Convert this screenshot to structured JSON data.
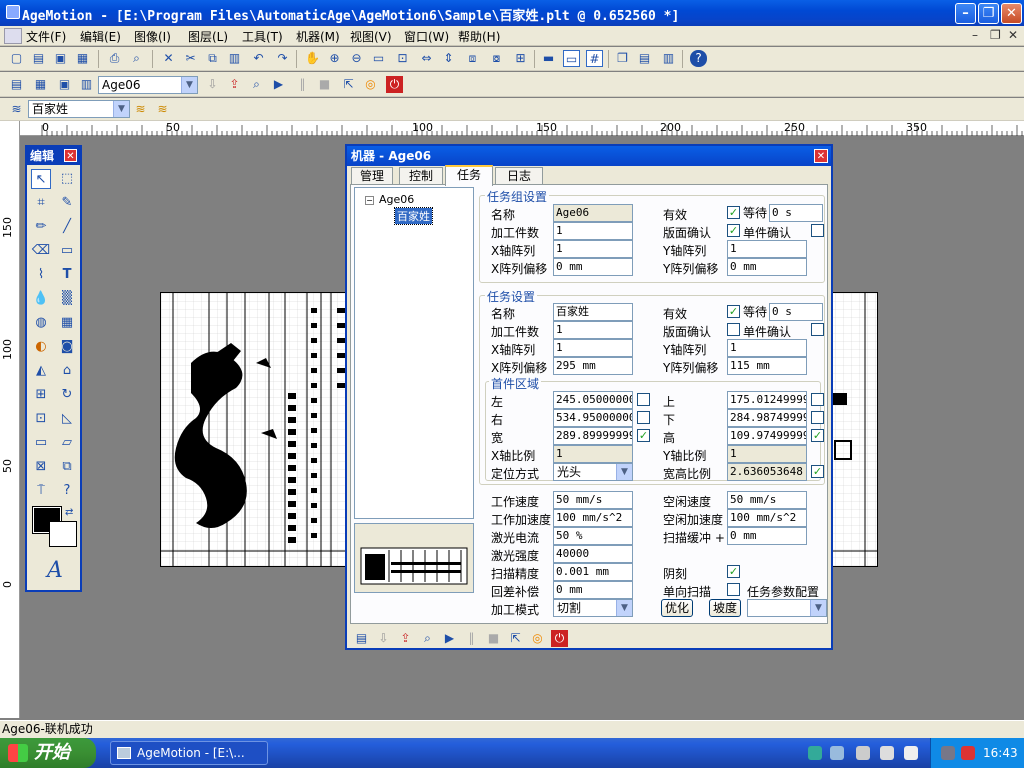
{
  "app": {
    "title": "AgeMotion - [E:\\Program Files\\AutomaticAge\\AgeMotion6\\Sample\\百家姓.plt @ 0.652560 *]"
  },
  "menu": [
    "文件(F)",
    "编辑(E)",
    "图像(I)",
    "图层(L)",
    "工具(T)",
    "机器(M)",
    "视图(V)",
    "窗口(W)",
    "帮助(H)"
  ],
  "toolbar2": {
    "machine": "Age06"
  },
  "toolbar3": {
    "layer": "百家姓"
  },
  "ruler": {
    "h": [
      "0",
      "50",
      "100",
      "150",
      "200",
      "250",
      "300",
      "350"
    ],
    "v": [
      "150",
      "100",
      "50",
      "0"
    ]
  },
  "palette": {
    "title": "编辑"
  },
  "dialog": {
    "title": "机器 - Age06",
    "tabs": [
      "管理",
      "控制",
      "任务",
      "日志"
    ],
    "tree": {
      "root": "Age06",
      "child": "百家姓"
    },
    "group_settings": {
      "title": "任务组设置",
      "name_label": "名称",
      "name": "Age06",
      "count_label": "加工件数",
      "count": "1",
      "xarr_label": "X轴阵列",
      "xarr": "1",
      "xoff_label": "X阵列偏移",
      "xoff": "0 mm",
      "valid_label": "有效",
      "wait_label": "等待",
      "wait": "0 s",
      "confirm_label": "版面确认",
      "piece_label": "单件确认",
      "yarr_label": "Y轴阵列",
      "yarr": "1",
      "yoff_label": "Y阵列偏移",
      "yoff": "0 mm"
    },
    "task_settings": {
      "title": "任务设置",
      "name_label": "名称",
      "name": "百家姓",
      "count_label": "加工件数",
      "count": "1",
      "xarr_label": "X轴阵列",
      "xarr": "1",
      "xoff_label": "X阵列偏移",
      "xoff": "295 mm",
      "valid_label": "有效",
      "wait_label": "等待",
      "wait": "0 s",
      "confirm_label": "版面确认",
      "piece_label": "单件确认",
      "yarr_label": "Y轴阵列",
      "yarr": "1",
      "yoff_label": "Y阵列偏移",
      "yoff": "115 mm"
    },
    "first_region": {
      "title": "首件区域",
      "left_label": "左",
      "left": "245.050000000",
      "right_label": "右",
      "right": "534.950000000",
      "width_label": "宽",
      "width": "289.899999999",
      "xscale_label": "X轴比例",
      "xscale": "1",
      "pos_label": "定位方式",
      "pos": "光头",
      "top_label": "上",
      "top": "175.012499999",
      "bottom_label": "下",
      "bottom": "284.987499999",
      "height_label": "高",
      "height": "109.974999999",
      "yscale_label": "Y轴比例",
      "yscale": "1",
      "ratio_label": "宽高比例",
      "ratio": "2.636053648"
    },
    "params": {
      "work_speed_label": "工作速度",
      "work_speed": "50 mm/s",
      "work_acc_label": "工作加速度",
      "work_acc": "100 mm/s^2",
      "laser_cur_label": "激光电流",
      "laser_cur": "50 %",
      "laser_int_label": "激光强度",
      "laser_int": "40000",
      "scan_prec_label": "扫描精度",
      "scan_prec": "0.001 mm",
      "backlash_label": "回差补偿",
      "backlash": "0 mm",
      "mode_label": "加工模式",
      "mode": "切割",
      "idle_speed_label": "空闲速度",
      "idle_speed": "50 mm/s",
      "idle_acc_label": "空闲加速度",
      "idle_acc": "100 mm/s^2",
      "scan_buf_label": "扫描缓冲 +",
      "scan_buf": "0 mm",
      "yin_label": "阴刻",
      "uni_label": "单向扫描",
      "task_param_label": "任务参数配置",
      "optimize_btn": "优化",
      "slope_btn": "坡度"
    }
  },
  "status": {
    "text": "Age06-联机成功"
  },
  "taskbar": {
    "start": "开始",
    "item": "AgeMotion - [E:\\...",
    "time": "16:43"
  },
  "colors": {
    "titlebar": "#0843c8",
    "taskbar": "#245edb",
    "start": "#3a8f33",
    "face": "#ece9d8"
  }
}
